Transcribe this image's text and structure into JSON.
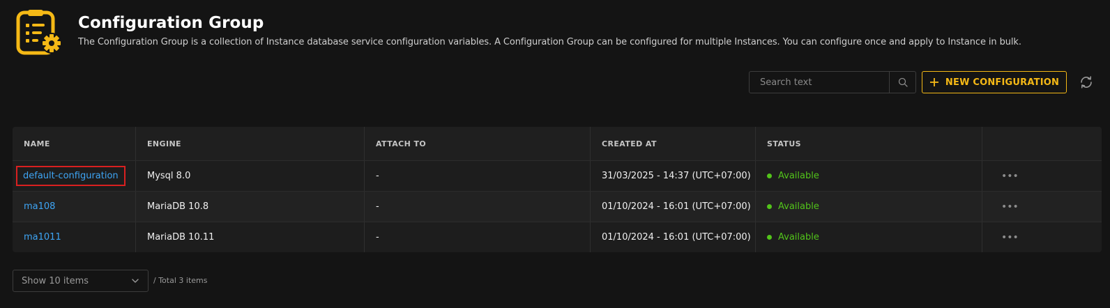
{
  "header": {
    "title": "Configuration Group",
    "description": "The Configuration Group is a collection of Instance database service configuration variables. A Configuration Group can be configured for multiple Instances. You can configure once and apply to Instance in bulk."
  },
  "toolbar": {
    "search_placeholder": "Search text",
    "new_button_label": "NEW CONFIGURATION"
  },
  "table": {
    "columns": [
      "NAME",
      "ENGINE",
      "ATTACH TO",
      "CREATED AT",
      "STATUS",
      ""
    ],
    "rows": [
      {
        "name": "default-configuration",
        "engine": "Mysql 8.0",
        "attach_to": "-",
        "created_at": "31/03/2025 - 14:37 (UTC+07:00)",
        "status": "Available"
      },
      {
        "name": "ma108",
        "engine": "MariaDB 10.8",
        "attach_to": "-",
        "created_at": "01/10/2024 - 16:01 (UTC+07:00)",
        "status": "Available"
      },
      {
        "name": "ma1011",
        "engine": "MariaDB 10.11",
        "attach_to": "-",
        "created_at": "01/10/2024 - 16:01 (UTC+07:00)",
        "status": "Available"
      }
    ],
    "more_glyph": "•••"
  },
  "pagination": {
    "page_size_label": "Show 10 items",
    "total_label": "/ Total 3 items"
  },
  "colors": {
    "accent": "#f5b916",
    "link": "#3ea5f5",
    "status_available": "#52c41a",
    "selection_outline": "#d92020"
  },
  "icons": {
    "header": "clipboard-gear-icon",
    "search": "search-icon",
    "new": "plus-icon",
    "refresh": "refresh-icon",
    "dropdown": "chevron-down-icon",
    "row_actions": "more-icon"
  }
}
